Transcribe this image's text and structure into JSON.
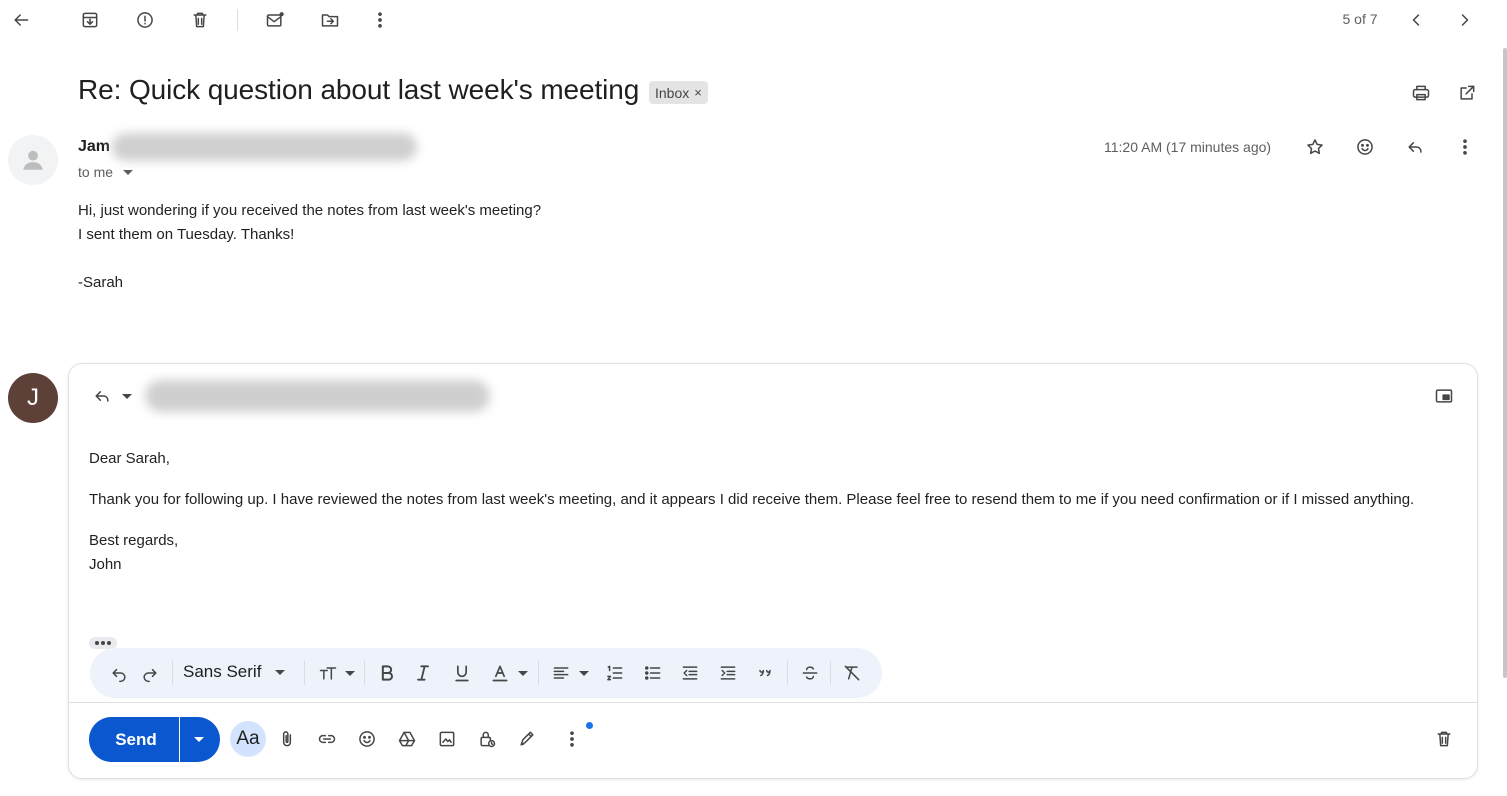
{
  "toolbar": {
    "back_icon": "arrow-left-icon",
    "archive_icon": "archive-icon",
    "spam_icon": "report-spam-icon",
    "delete_icon": "trash-icon",
    "mark_unread_icon": "mark-unread-icon",
    "move_icon": "move-to-folder-icon",
    "more_icon": "more-vertical-icon",
    "pager": "5 of 7",
    "prev_icon": "chevron-left-icon",
    "next_icon": "chevron-right-icon"
  },
  "thread": {
    "subject": "Re: Quick question about last week's meeting",
    "label": "Inbox",
    "label_remove": "×",
    "print_icon": "print-icon",
    "open_new_window_icon": "open-in-new-icon"
  },
  "message": {
    "sender_name": "Jam",
    "recipient_line": "to me",
    "time": "11:20 AM (17 minutes ago)",
    "body_lines": [
      "Hi, just wondering if you received the notes from last week's meeting?",
      "I sent them on Tuesday. Thanks!",
      "",
      "-Sarah"
    ]
  },
  "reply": {
    "avatar_initial": "J",
    "greeting": "Dear Sarah,",
    "paragraph": "Thank you for following up. I have reviewed the notes from last week's meeting, and it appears I did receive them. Please feel free to resend them to me if you need confirmation or if I missed anything.",
    "closing": "Best regards,",
    "signature": "John"
  },
  "formatting": {
    "font": "Sans Serif"
  },
  "compose_actions": {
    "send_label": "Send",
    "formatting_label": "Aa"
  },
  "colors": {
    "send_button": "#0b57d0",
    "format_bar": "#eef2fb",
    "reply_avatar": "#5d4037",
    "notification_dot": "#1a73e8"
  }
}
